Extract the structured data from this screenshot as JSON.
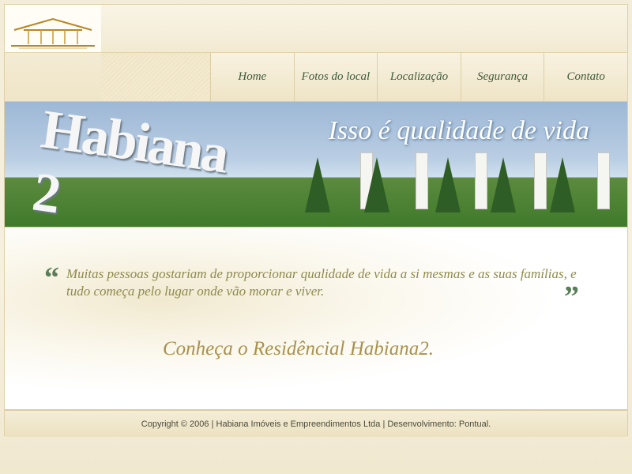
{
  "nav": {
    "items": [
      "Home",
      "Fotos do local",
      "Localização",
      "Segurança",
      "Contato"
    ]
  },
  "banner": {
    "brand": "Habiana 2",
    "tagline": "Isso é qualidade de vida"
  },
  "content": {
    "quote_open": "“",
    "quote_close": "”",
    "quote": "Muitas pessoas gostariam de proporcionar qualidade de vida a si mesmas e as suas famílias, e tudo começa pelo lugar onde vão morar e viver.",
    "cta": "Conheça o Residêncial Habiana2."
  },
  "footer": {
    "text": "Copyright © 2006 | Habiana Imóveis e Empreendimentos Ltda | Desenvolvimento: Pontual."
  },
  "colors": {
    "nav_text": "#3e5a3a",
    "quote_text": "#8e8a4c",
    "cta_text": "#a9914c",
    "accent_border": "#d9cba2"
  },
  "icons": {
    "logo": "house-roof-logo-icon"
  }
}
